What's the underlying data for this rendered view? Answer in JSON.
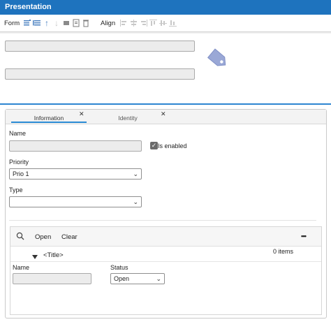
{
  "window": {
    "title": "Presentation"
  },
  "toolbar": {
    "form_label": "Form",
    "align_label": "Align",
    "form_icons": [
      "add-row-icon",
      "list-icon",
      "move-up-icon",
      "move-down-icon",
      "stop-icon",
      "document-icon",
      "delete-icon"
    ],
    "align_icons": [
      "align-left-icon",
      "align-center-icon",
      "align-right-icon",
      "align-top-icon",
      "align-middle-icon",
      "align-bottom-icon"
    ]
  },
  "header": {
    "logo_icon": "tag-icon",
    "accent_color": "#1e73be"
  },
  "tabs": [
    {
      "label": "Information",
      "active": true
    },
    {
      "label": "Identity",
      "active": false
    }
  ],
  "form": {
    "name_label": "Name",
    "is_enabled_label": "Is enabled",
    "is_enabled_checked": true,
    "priority_label": "Priority",
    "priority_value": "Prio 1",
    "type_label": "Type",
    "type_value": ""
  },
  "list": {
    "open_label": "Open",
    "clear_label": "Clear",
    "more_label": "•••",
    "count_label": "0 items",
    "group_title": "<Title>",
    "columns": {
      "name_label": "Name",
      "status_label": "Status",
      "status_value": "Open"
    }
  }
}
